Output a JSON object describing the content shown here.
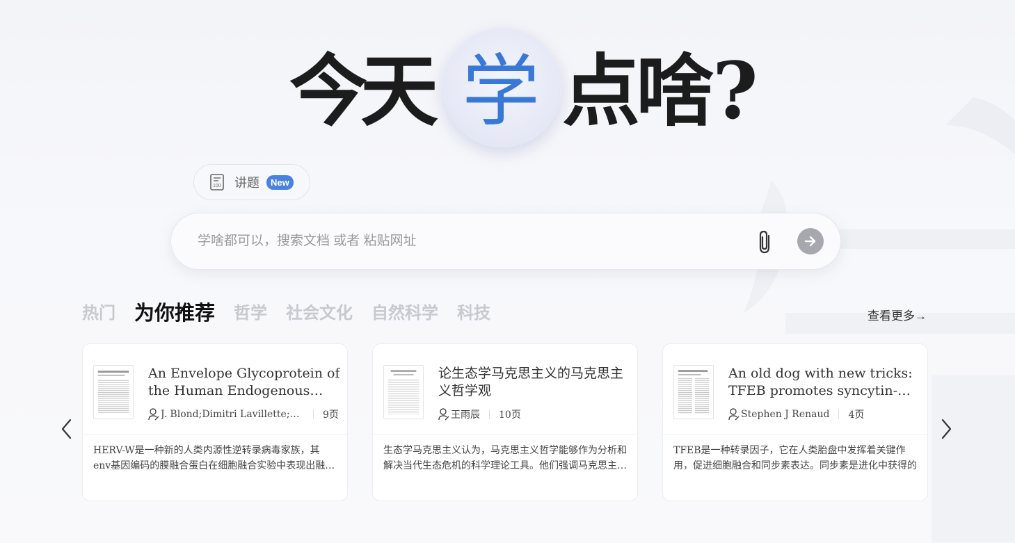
{
  "headline": {
    "char1": "今",
    "char2": "天",
    "char3": "学",
    "char4": "点",
    "char5": "啥",
    "char6": "?"
  },
  "feature_chip": {
    "label": "讲题",
    "badge": "New",
    "icon": "paper-100-icon"
  },
  "search": {
    "placeholder": "学啥都可以，搜索文档 或者 粘贴网址",
    "value": "",
    "attach_icon": "paperclip-icon",
    "submit_icon": "arrow-right-icon"
  },
  "tabs": [
    "热门",
    "为你推荐",
    "哲学",
    "社会文化",
    "自然科学",
    "科技"
  ],
  "active_tab": "为你推荐",
  "more_link": "查看更多→",
  "colors": {
    "accent": "#3a78d8",
    "badge": "#4a82e0",
    "inactive_tab": "#c7c9cf"
  },
  "cards": [
    {
      "title": "An Envelope Glycoprotein of the Human Endogenous Retrovirus HERV-W",
      "author": "J. Blond;Dimitri Lavillette;Valerie Cheynet",
      "pages": "9页",
      "desc": "HERV-W是一种新的人类内源性逆转录病毒家族，其env基因编码的膜融合蛋白在细胞融合实验中表现出融合活性"
    },
    {
      "title": "论生态学马克思主义的马克思主义哲学观",
      "author": "王雨辰",
      "pages": "10页",
      "desc": "生态学马克思主义认为，马克思主义哲学能够作为分析和解决当代生态危机的科学理论工具。他们强调马克思主义哲学"
    },
    {
      "title": "An old dog with new tricks: TFEB promotes syncytin-mediated fusion",
      "author": "Stephen J Renaud",
      "pages": "4页",
      "desc": "TFEB是一种转录因子，它在人类胎盘中发挥着关键作用，促进细胞融合和同步素表达。同步素是进化中获得的"
    }
  ]
}
